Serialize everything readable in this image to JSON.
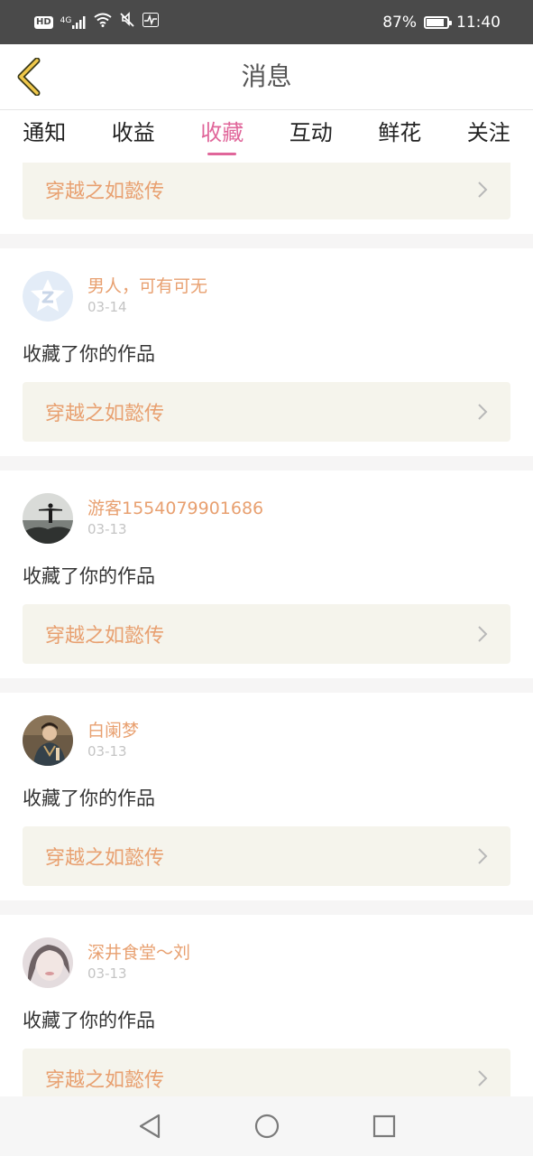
{
  "status_bar": {
    "network_badge": "HD",
    "signal_type": "4G",
    "battery_percent": "87%",
    "battery_level": 0.87,
    "time": "11:40",
    "icons": [
      "hd-icon",
      "signal-icon",
      "wifi-icon",
      "mute-icon",
      "activity-icon",
      "battery-icon"
    ]
  },
  "header": {
    "title": "消息",
    "back_icon": "chevron-left-icon",
    "accent_color": "#e0669a"
  },
  "tabs": [
    {
      "label": "通知",
      "active": false
    },
    {
      "label": "收益",
      "active": false
    },
    {
      "label": "收藏",
      "active": true
    },
    {
      "label": "互动",
      "active": false
    },
    {
      "label": "鲜花",
      "active": false
    },
    {
      "label": "关注",
      "active": false
    }
  ],
  "feed": {
    "partial_top": {
      "work_title": "穿越之如懿传"
    },
    "items": [
      {
        "username": "男人，可有可无",
        "date": "03-14",
        "action": "收藏了你的作品",
        "work_title": "穿越之如懿传",
        "avatar": "qzone-default-avatar"
      },
      {
        "username": "游客1554079901686",
        "date": "03-13",
        "action": "收藏了你的作品",
        "work_title": "穿越之如懿传",
        "avatar": "silhouette-photo-avatar"
      },
      {
        "username": "白阑梦",
        "date": "03-13",
        "action": "收藏了你的作品",
        "work_title": "穿越之如懿传",
        "avatar": "costume-photo-avatar"
      },
      {
        "username": "深井食堂～刘",
        "date": "03-13",
        "action": "收藏了你的作品",
        "work_title": "穿越之如懿传",
        "avatar": "blurred-photo-avatar"
      }
    ]
  },
  "colors": {
    "username": "#e8a070",
    "work_box_bg": "#f5f4ec",
    "status_bar_bg": "#4a4a4a"
  },
  "nav_bar": {
    "icons": [
      "back-triangle-icon",
      "home-circle-icon",
      "recents-square-icon"
    ]
  }
}
